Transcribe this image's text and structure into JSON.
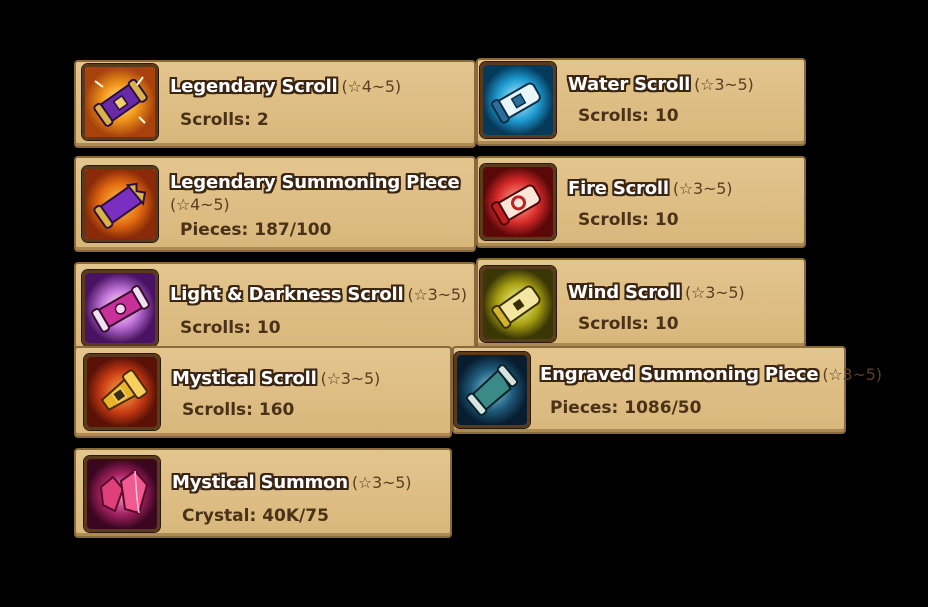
{
  "items": [
    {
      "name": "Legendary Scroll",
      "rank": "(☆4~5)",
      "count_label": "Scrolls: 2",
      "icon": "purple-scroll-icon"
    },
    {
      "name": "Legendary Summoning Piece",
      "rank": "(☆4~5)",
      "count_label": "Pieces: 187/100",
      "icon": "purple-scroll-piece-icon"
    },
    {
      "name": "Light & Darkness Scroll",
      "rank": "(☆3~5)",
      "count_label": "Scrolls: 10",
      "icon": "light-dark-scroll-icon"
    },
    {
      "name": "Mystical Scroll",
      "rank": "(☆3~5)",
      "count_label": "Scrolls: 160",
      "icon": "gold-scroll-icon"
    },
    {
      "name": "Mystical Summon",
      "rank": "(☆3~5)",
      "count_label": "Crystal: 40K/75",
      "icon": "crystal-icon"
    },
    {
      "name": "Water Scroll",
      "rank": "(☆3~5)",
      "count_label": "Scrolls: 10",
      "icon": "water-scroll-icon"
    },
    {
      "name": "Fire Scroll",
      "rank": "(☆3~5)",
      "count_label": "Scrolls: 10",
      "icon": "fire-scroll-icon"
    },
    {
      "name": "Wind Scroll",
      "rank": "(☆3~5)",
      "count_label": "Scrolls: 10",
      "icon": "wind-scroll-icon"
    },
    {
      "name": "Engraved Summoning Piece",
      "rank": "(☆3~5)",
      "count_label": "Pieces: 1086/50",
      "icon": "engraved-piece-icon"
    }
  ]
}
